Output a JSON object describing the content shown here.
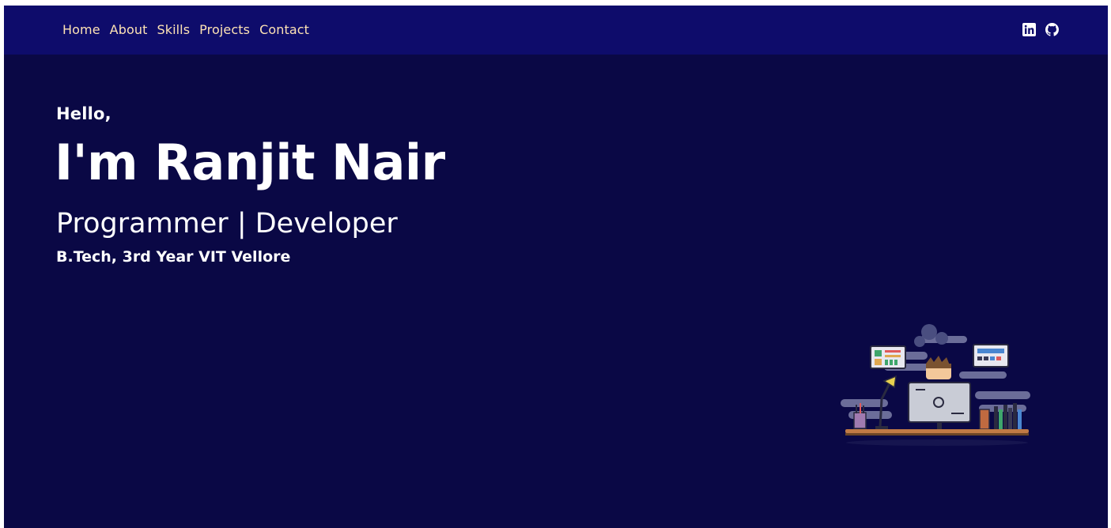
{
  "nav": {
    "links": [
      "Home",
      "About",
      "Skills",
      "Projects",
      "Contact"
    ]
  },
  "social": {
    "icons": [
      "linkedin-icon",
      "github-icon"
    ]
  },
  "hero": {
    "greeting": "Hello,",
    "name": "I'm Ranjit Nair",
    "role": "Programmer | Developer",
    "education": "B.Tech, 3rd Year VIT Vellore"
  },
  "colors": {
    "background": "#0a0845",
    "navbar": "#0e0c6b",
    "nav_text": "#fde2b4",
    "hero_text": "#ffffff"
  }
}
